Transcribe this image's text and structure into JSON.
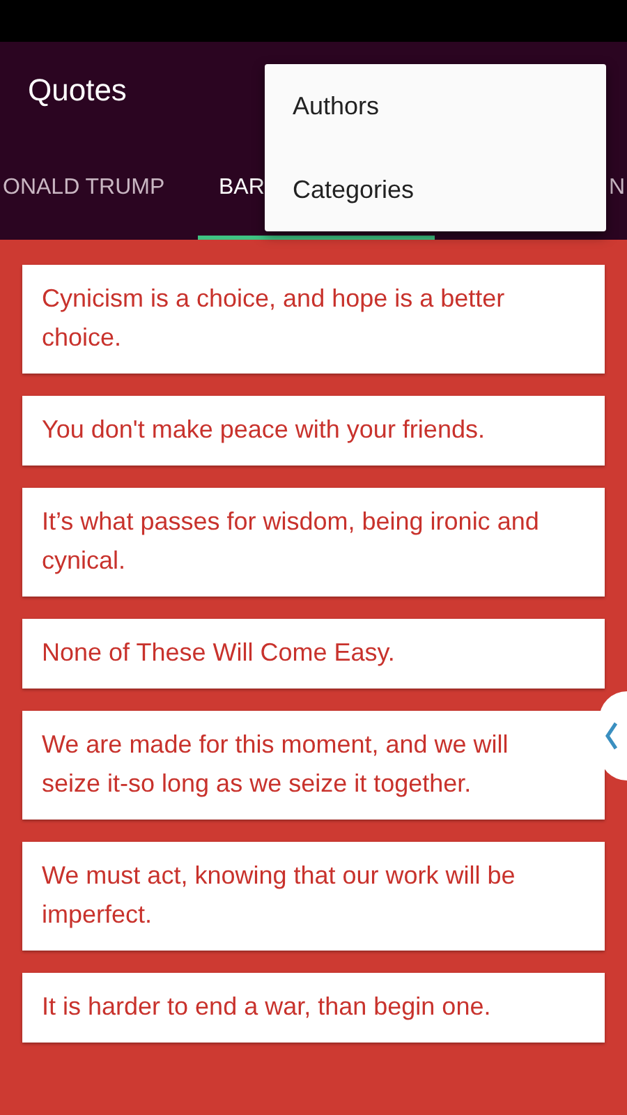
{
  "app_bar": {
    "title": "Quotes"
  },
  "tabs": [
    {
      "label": "ONALD TRUMP",
      "selected": false
    },
    {
      "label": "BAR",
      "selected": true
    },
    {
      "label": "N",
      "selected": false
    }
  ],
  "menu": {
    "items": [
      "Authors",
      "Categories"
    ]
  },
  "quotes": [
    "Cynicism is a choice, and hope is a better choice.",
    "You don't make peace with your friends.",
    "It’s what passes for wisdom, being ironic and cynical.",
    "None of These Will Come Easy.",
    "We are made for this moment, and we will seize it-so long as we seize it together.",
    "We must act, knowing that our work will be imperfect.",
    "It is harder to end a war, than begin one."
  ]
}
